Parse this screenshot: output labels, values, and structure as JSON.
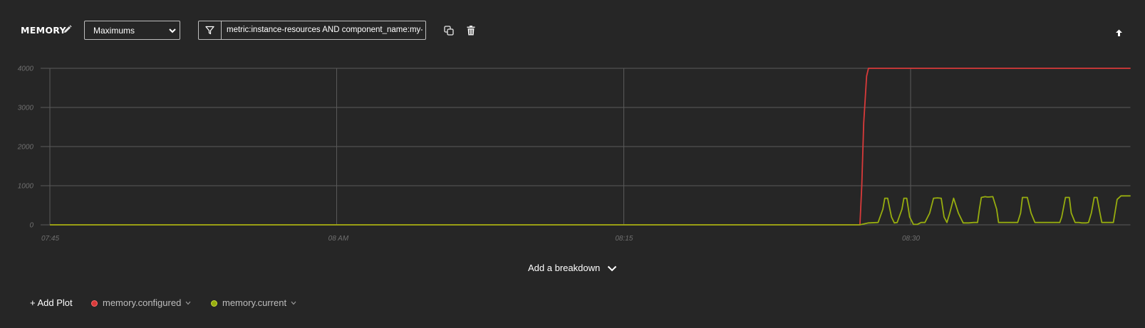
{
  "panel": {
    "title": "MEMORY",
    "aggregation": "Maximums",
    "filter_query": "metric:instance-resources AND component_name:my-"
  },
  "icons": {
    "edit": "pencil-icon",
    "dropdown": "chevron-down-icon",
    "filter": "filter-icon",
    "duplicate": "copy-icon",
    "delete": "trash-icon",
    "collapse": "arrow-up-icon"
  },
  "colors": {
    "background": "#262626",
    "grid": "#595959",
    "configured": "#d83a3a",
    "current": "#97ad0f"
  },
  "chart_data": {
    "type": "line",
    "x_tick_labels": [
      "07:45",
      "08 AM",
      "08:15",
      "08:30"
    ],
    "x_ticks_min": [
      0,
      15,
      30,
      45
    ],
    "xlim_min": [
      0,
      56.5
    ],
    "y_ticks": [
      0,
      1000,
      2000,
      3000,
      4000
    ],
    "ylim": [
      0,
      4000
    ],
    "grid": true,
    "series": [
      {
        "name": "memory.configured",
        "color": "#d83a3a",
        "x": [
          0,
          42.35,
          42.45,
          42.55,
          42.7,
          42.8,
          56.5
        ],
        "y": [
          0,
          0,
          1000,
          2600,
          3800,
          4000,
          4000
        ]
      },
      {
        "name": "memory.current",
        "color": "#97ad0f",
        "x": [
          0,
          42.35,
          42.8,
          43.3,
          43.55,
          43.65,
          43.8,
          44.0,
          44.15,
          44.3,
          44.55,
          44.65,
          44.8,
          44.95,
          45.15,
          45.35,
          45.55,
          45.65,
          45.75,
          46.0,
          46.2,
          46.4,
          46.6,
          46.75,
          46.9,
          47.05,
          47.25,
          47.5,
          47.75,
          48.05,
          48.3,
          48.5,
          48.6,
          48.7,
          48.9,
          49.0,
          49.1,
          49.3,
          49.5,
          49.6,
          49.75,
          49.9,
          50.4,
          50.6,
          50.75,
          50.85,
          51.1,
          51.3,
          51.5,
          51.65,
          51.8,
          51.95,
          52.15,
          52.25,
          52.6,
          52.8,
          52.9,
          53.1,
          53.3,
          53.4,
          53.6,
          53.8,
          53.95,
          54.2,
          54.3,
          54.45,
          54.6,
          54.75,
          54.9,
          55.0,
          55.2,
          55.5,
          55.6,
          55.8,
          56.0,
          56.5
        ],
        "y": [
          0,
          0,
          50,
          60,
          400,
          680,
          680,
          200,
          50,
          60,
          400,
          680,
          680,
          200,
          10,
          10,
          60,
          60,
          60,
          300,
          680,
          690,
          680,
          200,
          60,
          300,
          680,
          300,
          50,
          50,
          60,
          60,
          400,
          700,
          720,
          710,
          710,
          720,
          400,
          60,
          60,
          60,
          60,
          60,
          300,
          700,
          700,
          300,
          60,
          60,
          60,
          60,
          60,
          60,
          60,
          60,
          200,
          700,
          700,
          300,
          60,
          60,
          50,
          50,
          60,
          300,
          700,
          700,
          300,
          60,
          60,
          60,
          60,
          650,
          740,
          740
        ]
      }
    ]
  },
  "footer": {
    "breakdown_label": "Add a breakdown",
    "add_plot_label": "+ Add Plot",
    "legend": [
      {
        "label": "memory.configured",
        "color": "#d83a3a"
      },
      {
        "label": "memory.current",
        "color": "#97ad0f"
      }
    ]
  }
}
